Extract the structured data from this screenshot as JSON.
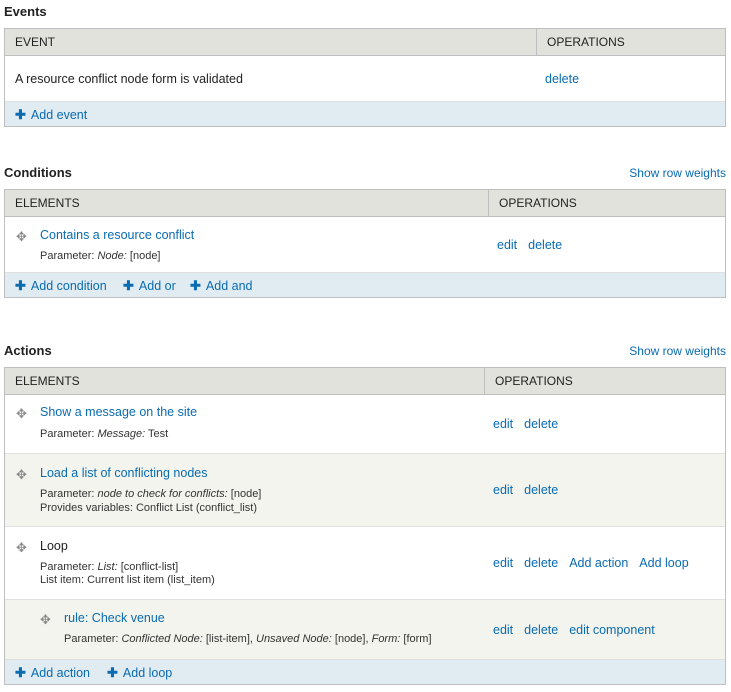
{
  "events": {
    "title": "Events",
    "col_event": "EVENT",
    "col_ops": "OPERATIONS",
    "row_text": "A resource conflict node form is validated",
    "row_delete": "delete",
    "add_event": "Add event"
  },
  "conditions": {
    "title": "Conditions",
    "row_weights": "Show row weights",
    "col_elements": "ELEMENTS",
    "col_ops": "OPERATIONS",
    "row": {
      "title": "Contains a resource conflict",
      "param_label": "Parameter:",
      "param_name": "Node:",
      "param_value": "[node]",
      "edit": "edit",
      "delete": "delete"
    },
    "add_condition": "Add condition",
    "add_or": "Add or",
    "add_and": "Add and"
  },
  "actions": {
    "title": "Actions",
    "row_weights": "Show row weights",
    "col_elements": "ELEMENTS",
    "col_ops": "OPERATIONS",
    "row1": {
      "title": "Show a message on the site",
      "param_label": "Parameter:",
      "param_name": "Message:",
      "param_value": "Test",
      "edit": "edit",
      "delete": "delete"
    },
    "row2": {
      "title": "Load a list of conflicting nodes",
      "param_label": "Parameter:",
      "param_name": "node to check for conflicts:",
      "param_value": "[node]",
      "provides": "Provides variables: Conflict List (conflict_list)",
      "edit": "edit",
      "delete": "delete"
    },
    "row3": {
      "title": "Loop",
      "param_label": "Parameter:",
      "param_name": "List:",
      "param_value": "[conflict-list]",
      "list_item": "List item: Current list item (list_item)",
      "edit": "edit",
      "delete": "delete",
      "add_action": "Add action",
      "add_loop": "Add loop"
    },
    "row4": {
      "title": "rule: Check venue",
      "param_label": "Parameter:",
      "p1_name": "Conflicted Node:",
      "p1_value": "[list-item],",
      "p2_name": "Unsaved Node:",
      "p2_value": "[node],",
      "p3_name": "Form:",
      "p3_value": "[form]",
      "edit": "edit",
      "delete": "delete",
      "edit_component": "edit component"
    },
    "add_action": "Add action",
    "add_loop": "Add loop"
  },
  "colors": {
    "link": "#0a6bb0",
    "header_bg": "#e1e2dc",
    "footer_bg": "#e1ecf2",
    "row_alt_bg": "#f3f4ee"
  }
}
